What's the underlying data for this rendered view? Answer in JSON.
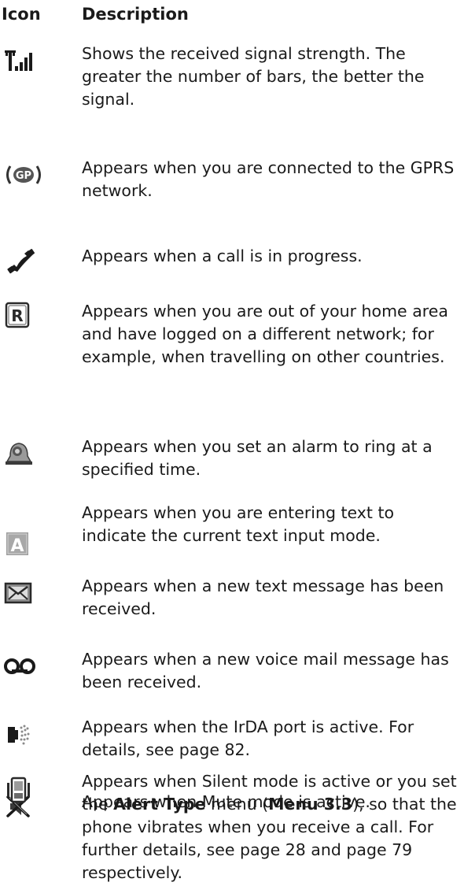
{
  "header": {
    "icon_col": "Icon",
    "desc_col": "Description"
  },
  "rows": [
    {
      "icon": "signal-strength-icon",
      "text": "Shows the received signal strength. The greater the number of bars, the better the signal."
    },
    {
      "icon": "gprs-icon",
      "icon_text": "GP",
      "text": "Appears when you are connected to the GPRS network."
    },
    {
      "icon": "call-in-progress-icon",
      "text": "Appears when a call is in progress."
    },
    {
      "icon": "roaming-icon",
      "icon_text": "R",
      "text": "Appears when you are out of your home area and have logged on a different network; for example, when travelling on other countries."
    },
    {
      "icon": "alarm-icon",
      "text": "Appears when you set an alarm to ring at a specified time."
    },
    {
      "icon": "text-input-mode-icon",
      "icon_text": "A",
      "text": "Appears when you are entering text to indicate the current text input mode."
    },
    {
      "icon": "new-message-icon",
      "text": "Appears when a new text message has been received."
    },
    {
      "icon": "voice-mail-icon",
      "text": "Appears when a new voice mail message has been received."
    },
    {
      "icon": "irda-icon",
      "text": "Appears when the IrDA port is active. For details, see page 82."
    },
    {
      "icon": "mute-icon",
      "text": "Appears when Mute mode is active."
    },
    {
      "icon": "silent-vibrate-icon",
      "text_parts": [
        "Appears when Silent mode is active or you set the ",
        "Alert Type",
        " menu (",
        "Menu 3.3",
        "), so that the phone vibrates when you receive a call. For further details, see page 28 and page 79 respectively."
      ]
    }
  ]
}
